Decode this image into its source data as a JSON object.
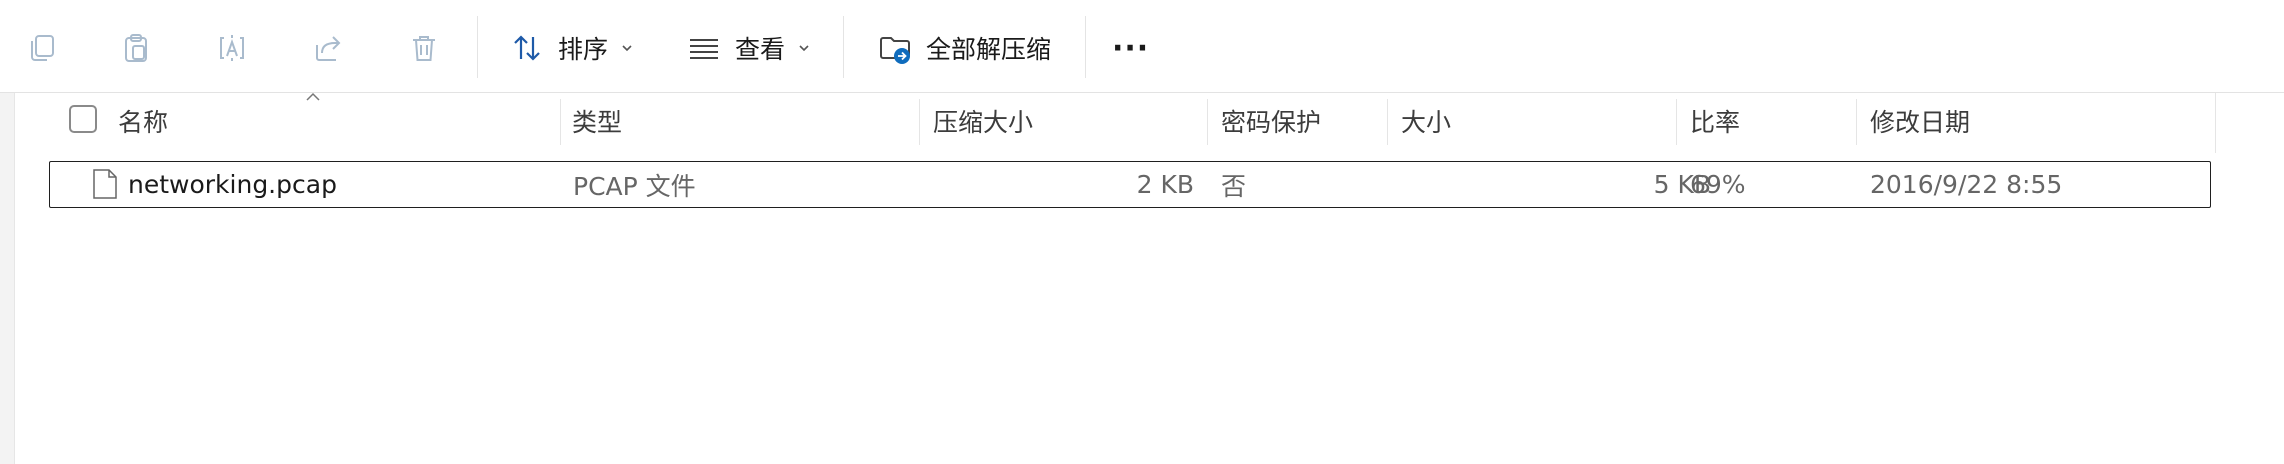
{
  "toolbar": {
    "sort_label": "排序",
    "view_label": "查看",
    "extract_all_label": "全部解压缩",
    "more_label": "···"
  },
  "columns": {
    "name": "名称",
    "type": "类型",
    "compressed_size": "压缩大小",
    "password": "密码保护",
    "size": "大小",
    "ratio": "比率",
    "modified": "修改日期"
  },
  "files": [
    {
      "name": "networking.pcap",
      "type": "PCAP 文件",
      "compressed_size": "2 KB",
      "password": "否",
      "size": "5 KB",
      "ratio": "69%",
      "modified": "2016/9/22 8:55"
    }
  ],
  "colors": {
    "accent": "#0063b1",
    "disabled_icon": "#9fb3c8"
  },
  "icons": [
    "copy-icon",
    "paste-icon",
    "rename-icon",
    "share-icon",
    "delete-icon",
    "sort-icon",
    "view-icon",
    "extract-folder-icon",
    "more-icon",
    "file-icon",
    "sort-caret-icon"
  ]
}
